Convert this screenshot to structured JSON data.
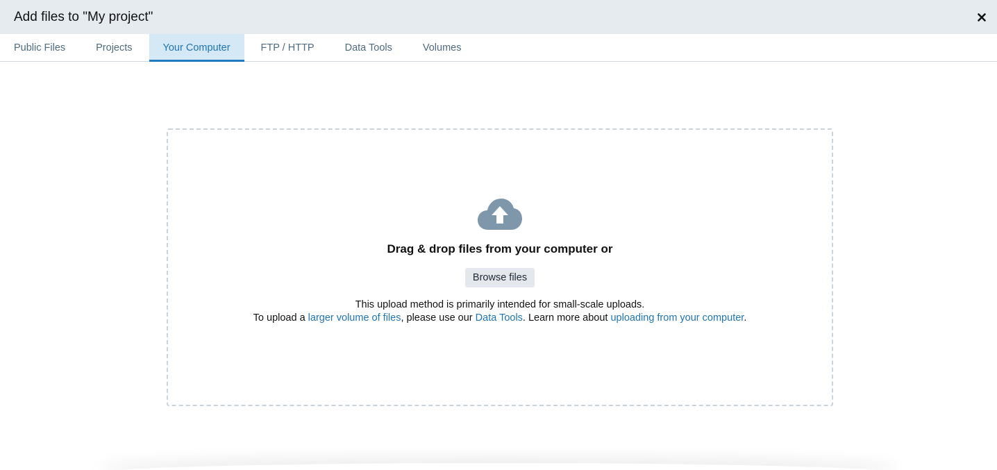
{
  "header": {
    "title": "Add files to \"My project\"",
    "close_icon": "close-icon"
  },
  "tabs": [
    {
      "label": "Public Files",
      "active": false
    },
    {
      "label": "Projects",
      "active": false
    },
    {
      "label": "Your Computer",
      "active": true
    },
    {
      "label": "FTP / HTTP",
      "active": false
    },
    {
      "label": "Data Tools",
      "active": false
    },
    {
      "label": "Volumes",
      "active": false
    }
  ],
  "dropzone": {
    "icon": "cloud-upload-icon",
    "drag_text": "Drag & drop files from your computer or",
    "browse_label": "Browse files",
    "info_line1": "This upload method is primarily intended for small-scale uploads.",
    "info_line2_part1": "To upload a ",
    "info_link1": "larger volume of files",
    "info_line2_part2": ", please use our ",
    "info_link2": "Data Tools",
    "info_line2_part3": ". Learn more about ",
    "info_link3": "uploading from your computer",
    "info_line2_part4": "."
  },
  "colors": {
    "header_bg": "#e6ebf0",
    "accent": "#1f74b5",
    "active_tab_bg": "#d4e8f6",
    "icon": "#7f97ab"
  }
}
